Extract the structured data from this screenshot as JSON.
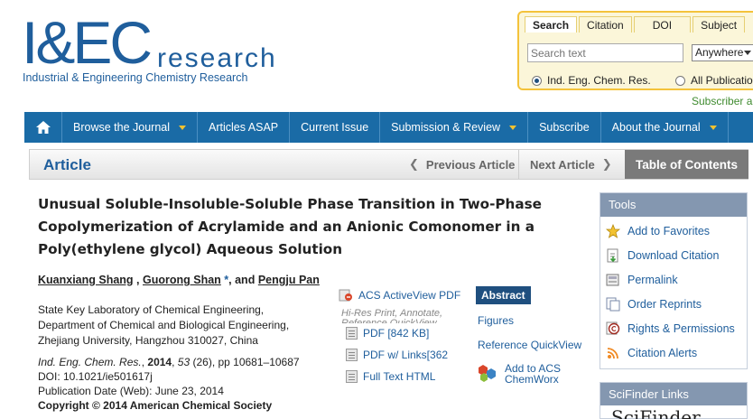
{
  "logo": {
    "main": "I&EC",
    "research": "research",
    "subtitle": "Industrial & Engineering Chemistry Research"
  },
  "search": {
    "tabs": [
      "Search",
      "Citation",
      "DOI",
      "Subject"
    ],
    "placeholder": "Search text",
    "scope_selected": "Anywhere",
    "radio_journal": "Ind. Eng. Chem. Res.",
    "radio_all": "All Publications"
  },
  "subscriber_text": "Subscriber a",
  "nav": {
    "home_icon": "home-icon",
    "items": [
      {
        "label": "Browse the Journal",
        "dropdown": true
      },
      {
        "label": "Articles ASAP",
        "dropdown": false
      },
      {
        "label": "Current Issue",
        "dropdown": false
      },
      {
        "label": "Submission & Review",
        "dropdown": true
      },
      {
        "label": "Subscribe",
        "dropdown": false
      },
      {
        "label": "About the Journal",
        "dropdown": true
      }
    ]
  },
  "article_bar": {
    "label": "Article",
    "prev": "Previous Article",
    "next": "Next Article",
    "toc": "Table of Contents"
  },
  "article": {
    "title": "Unusual Soluble-Insoluble-Soluble Phase Transition in Two-Phase Copolymerization of Acrylamide and an Anionic Comonomer in a Poly(ethylene glycol) Aqueous Solution",
    "authors": {
      "a1": "Kuanxiang Shang",
      "sep1": " , ",
      "a2": "Guorong Shan",
      "star": " *",
      "sep2": ", and ",
      "a3": "Pengju Pan"
    },
    "affiliation": [
      "State Key Laboratory of Chemical Engineering,",
      "Department of Chemical and Biological Engineering,",
      "Zhejiang University, Hangzhou 310027, China"
    ],
    "citation": {
      "journal": "Ind. Eng. Chem. Res.",
      "year_sep": ", ",
      "year": "2014",
      "vol_sep": ", ",
      "volume": "53",
      "issue_pages": " (26), pp 10681–10687",
      "doi": "DOI: 10.1021/ie501617j",
      "pubdate": "Publication Date (Web): June 23, 2014",
      "copyright": "Copyright © 2014 American Chemical Society"
    }
  },
  "access": {
    "activeview": "ACS ActiveView PDF",
    "activeview_sub": "Hi-Res Print, Annotate, Reference QuickView",
    "pdf": "PDF [842 KB]",
    "pdf_links": "PDF w/ Links[362",
    "fulltext": "Full Text HTML",
    "abstract": "Abstract",
    "figures": "Figures",
    "ref_quickview": "Reference QuickView",
    "chemworx_1": "Add to ACS",
    "chemworx_2": "ChemWorx"
  },
  "tools": {
    "head": "Tools",
    "items": [
      {
        "label": "Add to Favorites",
        "icon": "star-icon"
      },
      {
        "label": "Download Citation",
        "icon": "download-citation-icon"
      },
      {
        "label": "Permalink",
        "icon": "permalink-icon"
      },
      {
        "label": "Order Reprints",
        "icon": "reprints-icon"
      },
      {
        "label": "Rights & Permissions",
        "icon": "copyright-icon"
      },
      {
        "label": "Citation Alerts",
        "icon": "rss-icon"
      }
    ]
  },
  "scifinder": {
    "head": "SciFinder Links",
    "logo_text": "SciFinder"
  },
  "colors": {
    "brand_blue": "#1f5e9c",
    "nav_blue": "#1a6ba6",
    "search_border": "#f4c33b",
    "tools_head": "#8497b0"
  }
}
